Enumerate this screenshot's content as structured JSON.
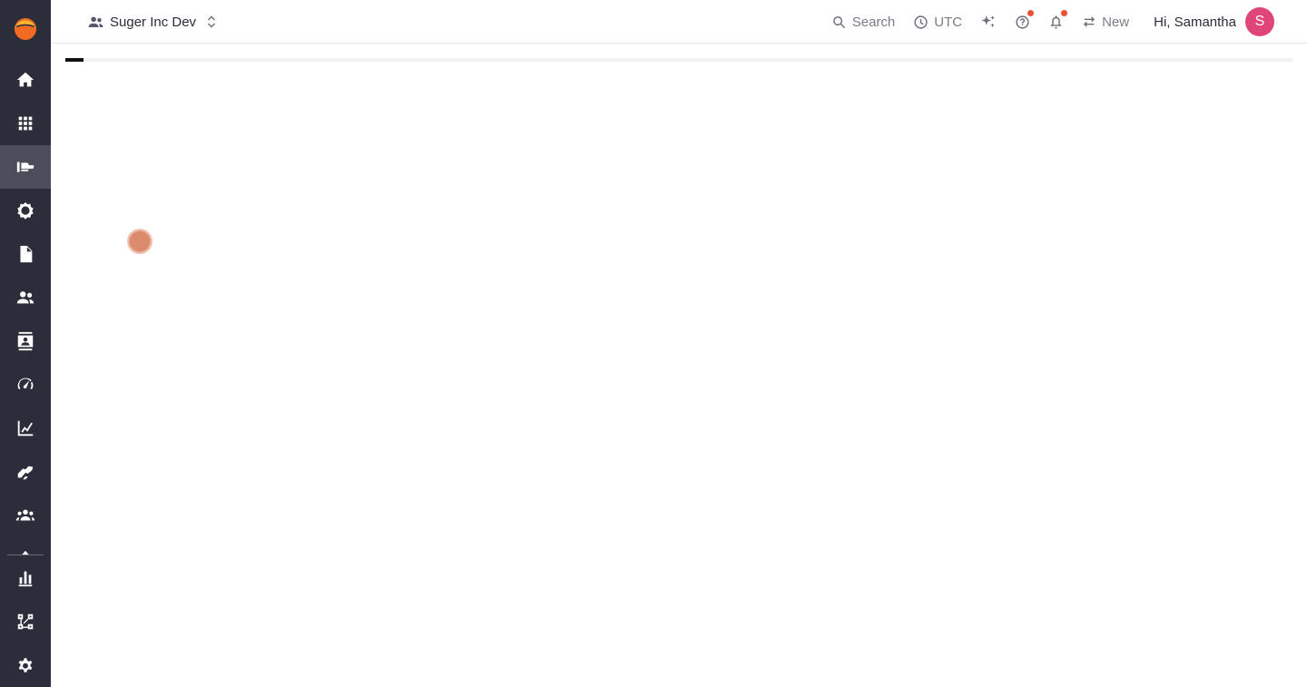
{
  "header": {
    "org_name": "Suger Inc Dev",
    "search_label": "Search",
    "timezone_label": "UTC",
    "new_label": "New",
    "greeting": "Hi, Samantha",
    "avatar_initial": "S"
  },
  "sidebar": {
    "active_item": "offers",
    "items": [
      {
        "key": "home",
        "icon": "home-icon"
      },
      {
        "key": "apps",
        "icon": "grid-icon"
      },
      {
        "key": "offers",
        "icon": "offer-hand-icon"
      },
      {
        "key": "products",
        "icon": "cog-outline-icon"
      },
      {
        "key": "documents",
        "icon": "file-icon"
      },
      {
        "key": "contacts",
        "icon": "people-icon"
      },
      {
        "key": "directory",
        "icon": "contact-card-icon"
      },
      {
        "key": "metering",
        "icon": "speedometer-icon"
      },
      {
        "key": "analytics",
        "icon": "trend-chart-icon"
      },
      {
        "key": "deals",
        "icon": "handshake-icon"
      },
      {
        "key": "partners",
        "icon": "groups-icon"
      },
      {
        "key": "reports",
        "icon": "bar-chart-icon"
      },
      {
        "key": "integrations",
        "icon": "workflow-icon"
      },
      {
        "key": "settings",
        "icon": "settings-gear-icon"
      }
    ]
  },
  "loading": {
    "progress_fraction": 0.015
  },
  "colors": {
    "sidebar_bg": "#2b2d3b",
    "sidebar_active": "#4b4d5b",
    "avatar_bg": "#e0457a",
    "notification_dot": "#e8503a",
    "brand_orange": "#f26b22"
  }
}
